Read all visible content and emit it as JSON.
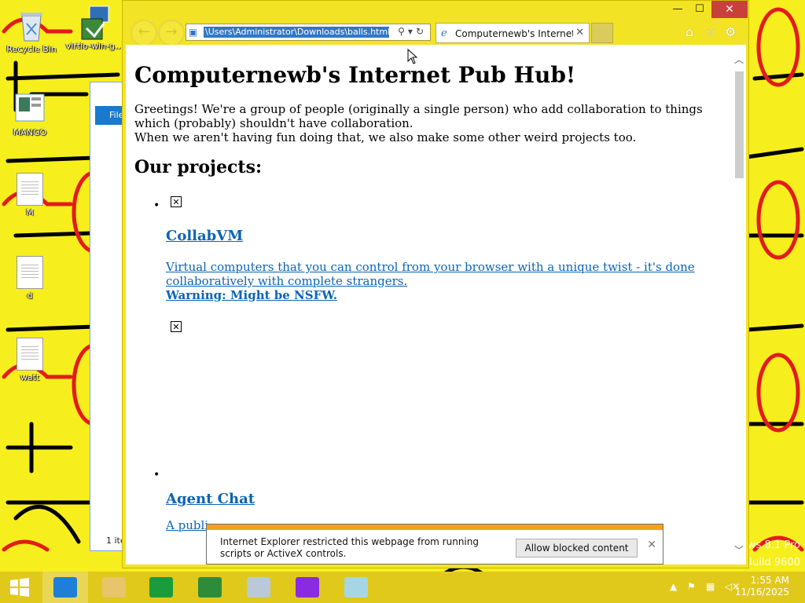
{
  "desktop": {
    "icons": [
      {
        "label": "Recycle Bin"
      },
      {
        "label": "virtio-win-g..."
      },
      {
        "label": "MANGO"
      },
      {
        "label": "M"
      },
      {
        "label": "d"
      },
      {
        "label": "watt"
      }
    ],
    "watermark": {
      "line1": "ws 8.1 Pro",
      "line2": "Build 9600"
    }
  },
  "explorer": {
    "file_tab": "File",
    "status": "1 ite"
  },
  "ie": {
    "address": "\\Users\\Administrator\\Downloads\\balls.html",
    "tab_title": "Computernewb's Internet P...",
    "controls": {
      "minimize": "—",
      "maximize": "☐",
      "close": "✕"
    }
  },
  "page": {
    "title": "Computernewb's Internet Pub Hub!",
    "intro_line1": "Greetings! We're a group of people (originally a single person) who add collaboration to things which (probably) shouldn't have collaboration.",
    "intro_line2": "When we aren't having fun doing that, we also make some other weird projects too.",
    "projects_heading": "Our projects:",
    "projects": [
      {
        "name": "CollabVM",
        "description": "Virtual computers that you can control from your browser with a unique twist - it's done collaboratively with complete strangers.",
        "warning": "Warning: Might be NSFW."
      },
      {
        "name": "Agent Chat",
        "description": "A publi"
      }
    ]
  },
  "notification": {
    "message": "Internet Explorer restricted this webpage from running scripts or ActiveX controls.",
    "button": "Allow blocked content",
    "close": "✕"
  },
  "taskbar": {
    "time": "1:55 AM",
    "date": "11/16/2025",
    "colors": {
      "ie": "#1e7fd6",
      "explorer": "#e8c46a",
      "store": "#1a9b3c",
      "taskmgr": "#2c8c3a",
      "mag": "#8a2be2"
    }
  }
}
